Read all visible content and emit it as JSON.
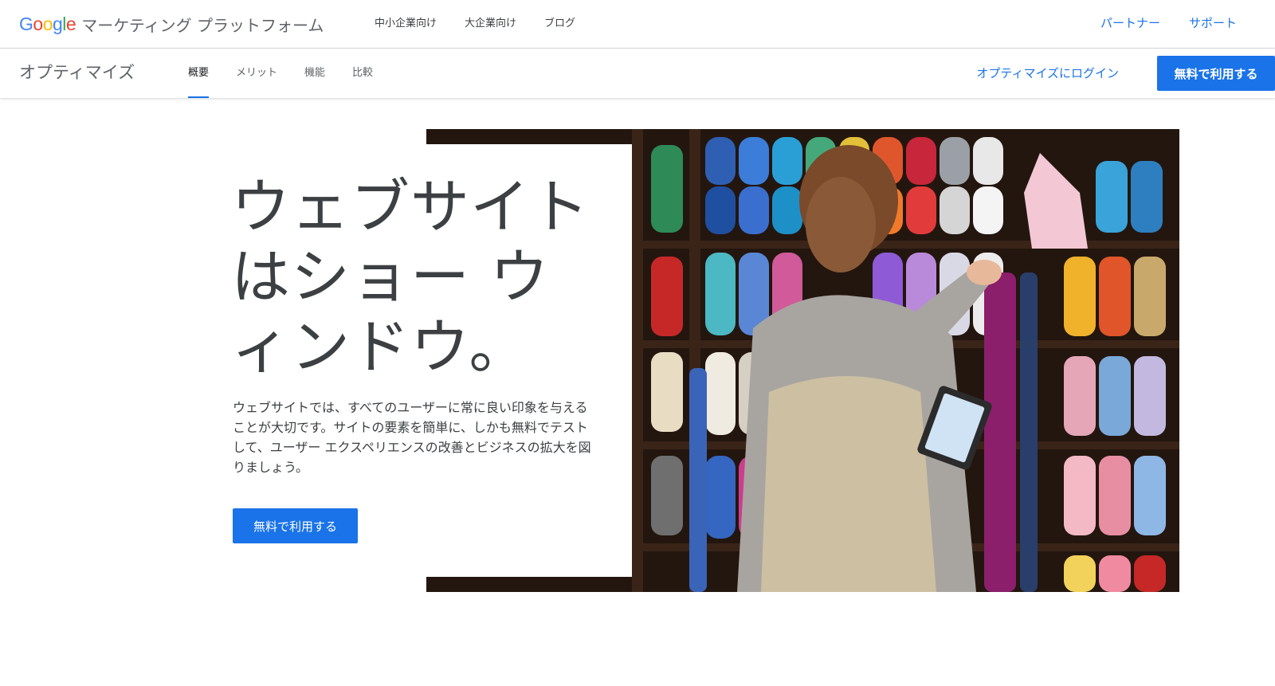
{
  "brand": {
    "logo_letters": [
      "G",
      "o",
      "o",
      "g",
      "l",
      "e"
    ],
    "platform_name": "マーケティング プラットフォーム"
  },
  "top_nav": {
    "items": [
      "中小企業向け",
      "大企業向け",
      "ブログ"
    ],
    "right_links": [
      "パートナー",
      "サポート"
    ]
  },
  "sub_nav": {
    "product_name": "オプティマイズ",
    "tabs": [
      {
        "label": "概要",
        "active": true
      },
      {
        "label": "メリット",
        "active": false
      },
      {
        "label": "機能",
        "active": false
      },
      {
        "label": "比較",
        "active": false
      }
    ],
    "login_link": "オプティマイズにログイン",
    "cta_label": "無料で利用する"
  },
  "hero": {
    "title": "ウェブサイトはショー ウィンドウ。",
    "body": "ウェブサイトでは、すべてのユーザーに常に良い印象を与えることが大切です。サイトの要素を簡単に、しかも無料でテストして、ユーザー エクスペリエンスの改善とビジネスの拡大を図りましょう。",
    "cta_label": "無料で利用する"
  },
  "colors": {
    "accent": "#1a73e8",
    "text": "#3c4043",
    "muted": "#5f6368"
  }
}
